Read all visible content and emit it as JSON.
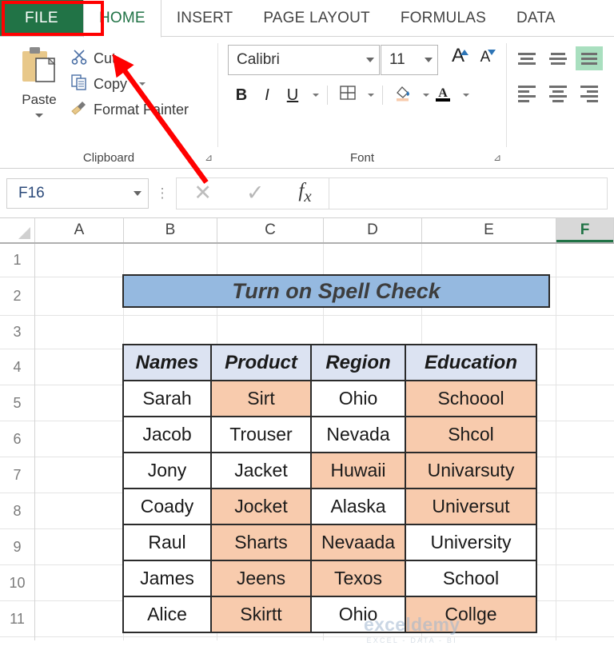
{
  "ribbon": {
    "tabs": [
      {
        "label": "FILE",
        "active": false,
        "kind": "file"
      },
      {
        "label": "HOME",
        "active": true
      },
      {
        "label": "INSERT",
        "active": false
      },
      {
        "label": "PAGE LAYOUT",
        "active": false
      },
      {
        "label": "FORMULAS",
        "active": false
      },
      {
        "label": "DATA",
        "active": false
      }
    ],
    "clipboard": {
      "group_label": "Clipboard",
      "paste_label": "Paste",
      "cut_label": "Cut",
      "copy_label": "Copy",
      "format_painter_label": "Format Painter"
    },
    "font": {
      "group_label": "Font",
      "font_name": "Calibri",
      "font_size": "11",
      "bold_label": "B",
      "italic_label": "I",
      "underline_label": "U",
      "grow_font_label": "A",
      "shrink_font_label": "A",
      "font_color_label": "A"
    },
    "alignment": {
      "top_align": "top-align",
      "middle_align": "middle-align",
      "bottom_align": "bottom-align",
      "left_align": "align-left",
      "center_align": "align-center",
      "right_align": "align-right",
      "active": "middle-align",
      "highlight_color": "#a9dfbf"
    }
  },
  "formula_bar": {
    "name_box_value": "F16",
    "cancel_icon": "cancel-icon",
    "enter_icon": "enter-icon",
    "function_icon": "fx",
    "formula_value": ""
  },
  "grid": {
    "columns": [
      "A",
      "B",
      "C",
      "D",
      "E",
      "F"
    ],
    "selected_column": "F",
    "rows": [
      "1",
      "2",
      "3",
      "4",
      "5",
      "6",
      "7",
      "8",
      "9",
      "10",
      "11"
    ]
  },
  "sheet_content": {
    "title": "Turn on Spell Check",
    "title_fill": "#95b9e0",
    "header_fill": "#dce3f2",
    "error_fill": "#f8cbad",
    "headers": [
      "Names",
      "Product",
      "Region",
      "Education"
    ],
    "rows": [
      {
        "cells": [
          {
            "text": "Sarah",
            "fill": "none"
          },
          {
            "text": "Sirt",
            "fill": "peach"
          },
          {
            "text": "Ohio",
            "fill": "none"
          },
          {
            "text": "Schoool",
            "fill": "peach"
          }
        ]
      },
      {
        "cells": [
          {
            "text": "Jacob",
            "fill": "none"
          },
          {
            "text": "Trouser",
            "fill": "none"
          },
          {
            "text": "Nevada",
            "fill": "none"
          },
          {
            "text": "Shcol",
            "fill": "peach"
          }
        ]
      },
      {
        "cells": [
          {
            "text": "Jony",
            "fill": "none"
          },
          {
            "text": "Jacket",
            "fill": "none"
          },
          {
            "text": "Huwaii",
            "fill": "peach"
          },
          {
            "text": "Univarsuty",
            "fill": "peach"
          }
        ]
      },
      {
        "cells": [
          {
            "text": "Coady",
            "fill": "none"
          },
          {
            "text": "Jocket",
            "fill": "peach"
          },
          {
            "text": "Alaska",
            "fill": "none"
          },
          {
            "text": "Universut",
            "fill": "peach"
          }
        ]
      },
      {
        "cells": [
          {
            "text": "Raul",
            "fill": "none"
          },
          {
            "text": "Sharts",
            "fill": "peach"
          },
          {
            "text": "Nevaada",
            "fill": "peach"
          },
          {
            "text": "University",
            "fill": "none"
          }
        ]
      },
      {
        "cells": [
          {
            "text": "James",
            "fill": "none"
          },
          {
            "text": "Jeens",
            "fill": "peach"
          },
          {
            "text": "Texos",
            "fill": "peach"
          },
          {
            "text": "School",
            "fill": "none"
          }
        ]
      },
      {
        "cells": [
          {
            "text": "Alice",
            "fill": "none"
          },
          {
            "text": "Skirtt",
            "fill": "peach"
          },
          {
            "text": "Ohio",
            "fill": "none"
          },
          {
            "text": "Collge",
            "fill": "peach"
          }
        ]
      }
    ]
  },
  "annotation": {
    "highlight_color": "#ff0000",
    "arrow": "red-arrow-pointing-to-file-tab"
  },
  "watermark": {
    "main": "exceldemy",
    "sub": "EXCEL - DATA - BI"
  }
}
